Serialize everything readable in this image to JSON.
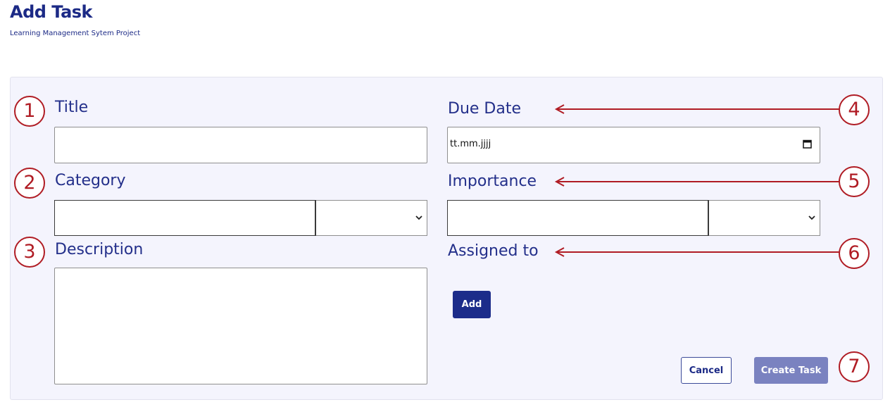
{
  "header": {
    "title": "Add Task",
    "subtitle": "Learning Management Sytem Project"
  },
  "form": {
    "title_label": "Title",
    "title_value": "",
    "category_label": "Category",
    "category_value": "",
    "category_selected": "",
    "description_label": "Description",
    "description_value": "",
    "due_date_label": "Due Date",
    "due_date_placeholder": "tt.mm.jjjj",
    "importance_label": "Importance",
    "importance_value": "",
    "importance_selected": "",
    "assigned_label": "Assigned to",
    "add_button": "Add",
    "cancel_button": "Cancel",
    "create_button": "Create Task"
  },
  "annotations": {
    "markers": [
      "1",
      "2",
      "3",
      "4",
      "5",
      "6",
      "7"
    ],
    "color": "#b01c24"
  },
  "colors": {
    "primary": "#1c2c8a",
    "primary_disabled": "#7a82c0",
    "panel_bg": "#f4f4fd"
  },
  "icons": {
    "date": "calendar-icon",
    "select": "chevron-down-icon"
  }
}
